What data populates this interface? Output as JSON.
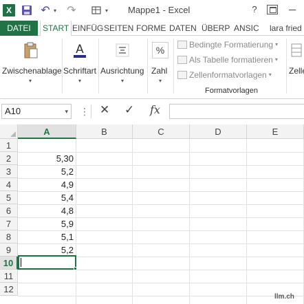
{
  "titlebar": {
    "app_logo": "X",
    "title": "Mappe1 - Excel",
    "help": "?",
    "icons": {
      "save": "save-icon",
      "undo": "undo-icon",
      "redo": "redo-icon",
      "customize": "customize-qat-icon"
    }
  },
  "tabs": {
    "file": "DATEI",
    "items": [
      "START",
      "EINFÜG",
      "SEITEN",
      "FORME",
      "DATEN",
      "ÜBERP",
      "ANSIC"
    ],
    "active": "START",
    "user": "lara fried"
  },
  "ribbon": {
    "clipboard": "Zwischenablage",
    "font": "Schriftart",
    "alignment": "Ausrichtung",
    "number": "Zahl",
    "number_symbol": "%",
    "styles": {
      "conditional": "Bedingte Formatierung",
      "as_table": "Als Tabelle formatieren",
      "cell_styles": "Zellenformatvorlagen",
      "caption": "Formatvorlagen"
    },
    "cells": "Zelle"
  },
  "formula_bar": {
    "name_box": "A10",
    "fx": "fx",
    "value": ""
  },
  "grid": {
    "columns": [
      "A",
      "B",
      "C",
      "D",
      "E"
    ],
    "selected_column": "A",
    "rows": [
      "1",
      "2",
      "3",
      "4",
      "5",
      "6",
      "7",
      "8",
      "9",
      "10",
      "11",
      "12"
    ],
    "selected_row": "10",
    "values_col_a": [
      "",
      "5,30",
      "5,2",
      "4,9",
      "5,4",
      "4,8",
      "5,9",
      "5,1",
      "5,2",
      "",
      "",
      ""
    ],
    "active_cell": "A10"
  },
  "watermark": "llm.ch",
  "colors": {
    "excel_green": "#217346",
    "header_bg": "#f3f3f3",
    "gridline": "#e1e1e1"
  }
}
